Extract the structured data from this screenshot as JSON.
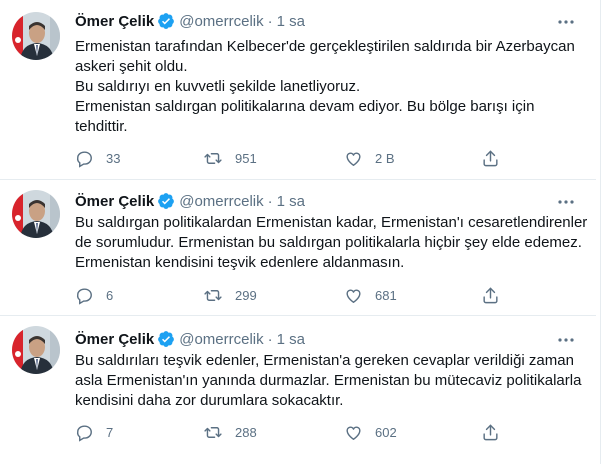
{
  "tweets": [
    {
      "author": {
        "name": "Ömer Çelik",
        "handle": "@omerrcelik",
        "time": "1 sa"
      },
      "lines": [
        "Ermenistan tarafından Kelbecer'de gerçekleştirilen saldırıda bir Azerbaycan",
        "askeri şehit oldu.",
        "Bu saldırıyı en kuvvetli şekilde lanetliyoruz.",
        "Ermenistan saldırgan politikalarına devam ediyor. Bu bölge barışı için",
        "tehdittir."
      ],
      "stats": {
        "replies": "33",
        "retweets": "951",
        "likes": "2 B"
      }
    },
    {
      "author": {
        "name": "Ömer Çelik",
        "handle": "@omerrcelik",
        "time": "1 sa"
      },
      "lines": [
        "Bu saldırgan politikalardan Ermenistan kadar, Ermenistan'ı cesaretlendirenler",
        "de sorumludur. Ermenistan bu saldırgan politikalarla hiçbir şey elde edemez.",
        "Ermenistan kendisini teşvik edenlere aldanmasın."
      ],
      "stats": {
        "replies": "6",
        "retweets": "299",
        "likes": "681"
      }
    },
    {
      "author": {
        "name": "Ömer Çelik",
        "handle": "@omerrcelik",
        "time": "1 sa"
      },
      "lines": [
        "Bu saldırıları teşvik edenler, Ermenistan'a gereken cevaplar verildiği zaman",
        "asla Ermenistan'ın yanında durmazlar. Ermenistan bu mütecaviz politikalarla",
        "kendisini daha zor durumlara sokacaktır."
      ],
      "stats": {
        "replies": "7",
        "retweets": "288",
        "likes": "602"
      }
    }
  ],
  "icons": {
    "verified": "verified-badge-icon",
    "more": "more-options-icon",
    "reply": "reply-icon",
    "retweet": "retweet-icon",
    "like": "like-icon",
    "share": "share-icon"
  },
  "colors": {
    "text": "#0f1419",
    "secondary": "#5b7083",
    "verified": "#1da1f2",
    "divider": "#e6ecf0",
    "flag_red": "#d8242c"
  }
}
